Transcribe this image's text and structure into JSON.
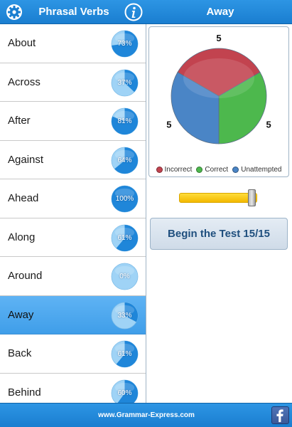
{
  "header": {
    "app_title": "Phrasal Verbs",
    "detail_title": "Away",
    "icons": {
      "settings": "gear-icon",
      "info": "info-icon"
    }
  },
  "list": {
    "items": [
      {
        "label": "About",
        "progress": 73,
        "progress_text": "73%",
        "selected": false
      },
      {
        "label": "Across",
        "progress": 37,
        "progress_text": "37%",
        "selected": false
      },
      {
        "label": "After",
        "progress": 81,
        "progress_text": "81%",
        "selected": false
      },
      {
        "label": "Against",
        "progress": 64,
        "progress_text": "64%",
        "selected": false
      },
      {
        "label": "Ahead",
        "progress": 100,
        "progress_text": "100%",
        "selected": false
      },
      {
        "label": "Along",
        "progress": 61,
        "progress_text": "61%",
        "selected": false
      },
      {
        "label": "Around",
        "progress": 0,
        "progress_text": "0%",
        "selected": false
      },
      {
        "label": "Away",
        "progress": 33,
        "progress_text": "33%",
        "selected": true
      },
      {
        "label": "Back",
        "progress": 61,
        "progress_text": "61%",
        "selected": false
      },
      {
        "label": "Behind",
        "progress": 60,
        "progress_text": "60%",
        "selected": false
      }
    ]
  },
  "chart_data": {
    "type": "pie",
    "categories": [
      "Incorrect",
      "Correct",
      "Unattempted"
    ],
    "values": [
      5,
      5,
      5
    ],
    "value_labels": [
      "5",
      "5",
      "5"
    ],
    "colors": [
      "#c2434f",
      "#4db84d",
      "#4a85c6"
    ],
    "legend": "bottom"
  },
  "slider": {
    "value": 15,
    "max": 15
  },
  "begin_button": {
    "label": "Begin the Test 15/15"
  },
  "footer": {
    "link_text": "www.Grammar-Express.com",
    "facebook_icon": "facebook-icon"
  },
  "colors": {
    "bar_blue": "#1f86d9",
    "selected_row": "#4aa6ee",
    "slider_yellow": "#f7c600",
    "button_text": "#1f4f7e"
  }
}
